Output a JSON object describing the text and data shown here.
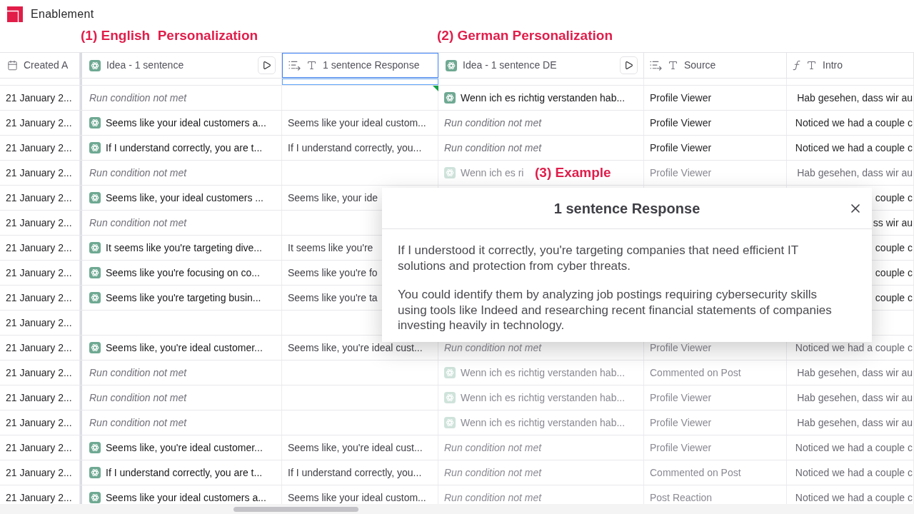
{
  "app": {
    "name": "Enablement"
  },
  "group_labels": [
    "(1) English  Personalization",
    "(2) German Personalization"
  ],
  "table": {
    "columns": [
      {
        "label": "Created A",
        "kind": "date",
        "selected": false
      },
      {
        "label": "Idea - 1 sentence",
        "kind": "ai",
        "selected": false
      },
      {
        "label": "1 sentence Response",
        "kind": "lookup",
        "selected": true
      },
      {
        "label": "Idea - 1 sentence DE",
        "kind": "ai",
        "selected": false
      },
      {
        "label": "Source",
        "kind": "lookup",
        "selected": false
      },
      {
        "label": "Intro",
        "kind": "formula",
        "selected": false
      }
    ],
    "rows": [
      {
        "dimmed": false,
        "cells": [
          {
            "kind": "text",
            "text": "21 January 2..."
          },
          {
            "kind": "skipped",
            "text": "Run condition not met"
          },
          null,
          {
            "kind": "ai",
            "text": "Wenn ich es richtig verstanden hab..."
          },
          {
            "kind": "text",
            "text": "Profile Viewer"
          },
          {
            "kind": "text",
            "text": "Hab gesehen, dass wir au"
          }
        ]
      },
      {
        "dimmed": false,
        "cells": [
          {
            "kind": "text",
            "text": "21 January 2..."
          },
          {
            "kind": "ai",
            "text": "Seems like your ideal customers a..."
          },
          {
            "kind": "text",
            "text": "Seems like your ideal custom..."
          },
          {
            "kind": "skipped",
            "text": "Run condition not met"
          },
          {
            "kind": "text",
            "text": "Profile Viewer"
          },
          {
            "kind": "text",
            "text": "Noticed we had a couple c"
          }
        ]
      },
      {
        "dimmed": false,
        "cells": [
          {
            "kind": "text",
            "text": "21 January 2..."
          },
          {
            "kind": "ai",
            "text": "If I understand correctly, you are t..."
          },
          {
            "kind": "text",
            "text": "If I understand correctly, you..."
          },
          {
            "kind": "skipped",
            "text": "Run condition not met"
          },
          {
            "kind": "text",
            "text": "Profile Viewer"
          },
          {
            "kind": "text",
            "text": "Noticed we had a couple c"
          }
        ]
      },
      {
        "dimmed": true,
        "cells": [
          {
            "kind": "text",
            "text": "21 January 2..."
          },
          {
            "kind": "skipped",
            "text": "Run condition not met"
          },
          null,
          {
            "kind": "ai",
            "text": "Wenn ich es ri"
          },
          {
            "kind": "text",
            "text": "Profile Viewer"
          },
          {
            "kind": "text",
            "text": "Hab gesehen, dass wir au"
          }
        ]
      },
      {
        "dimmed": false,
        "cells": [
          {
            "kind": "text",
            "text": "21 January 2..."
          },
          {
            "kind": "ai",
            "text": "Seems like, your ideal customers ..."
          },
          {
            "kind": "text",
            "text": "Seems like, your ide"
          },
          null,
          null,
          {
            "kind": "text",
            "text": "couple c"
          }
        ]
      },
      {
        "dimmed": false,
        "cells": [
          {
            "kind": "text",
            "text": "21 January 2..."
          },
          {
            "kind": "skipped",
            "text": "Run condition not met"
          },
          null,
          null,
          null,
          {
            "kind": "text",
            "text": "ss wir au"
          }
        ]
      },
      {
        "dimmed": false,
        "cells": [
          {
            "kind": "text",
            "text": "21 January 2..."
          },
          {
            "kind": "ai",
            "text": "It seems like you're targeting dive..."
          },
          {
            "kind": "text",
            "text": "It seems like you're"
          },
          null,
          null,
          {
            "kind": "text",
            "text": "couple c"
          }
        ]
      },
      {
        "dimmed": false,
        "cells": [
          {
            "kind": "text",
            "text": "21 January 2..."
          },
          {
            "kind": "ai",
            "text": "Seems like you're focusing on co..."
          },
          {
            "kind": "text",
            "text": "Seems like you're fo"
          },
          null,
          null,
          {
            "kind": "text",
            "text": "couple c"
          }
        ]
      },
      {
        "dimmed": false,
        "cells": [
          {
            "kind": "text",
            "text": "21 January 2..."
          },
          {
            "kind": "ai",
            "text": "Seems like you're targeting busin..."
          },
          {
            "kind": "text",
            "text": "Seems like you're ta"
          },
          null,
          null,
          {
            "kind": "text",
            "text": "couple c"
          }
        ]
      },
      {
        "cells": [
          {
            "kind": "text",
            "text": "21 January 2..."
          },
          null,
          null,
          null,
          null,
          null
        ]
      },
      {
        "dimmed": true,
        "cells": [
          {
            "kind": "text",
            "text": "21 January 2..."
          },
          {
            "kind": "ai",
            "text": "Seems like, you're ideal customer..."
          },
          {
            "kind": "text",
            "text": "Seems like, you're ideal cust..."
          },
          {
            "kind": "skipped",
            "text": "Run condition not met"
          },
          {
            "kind": "text",
            "text": "Profile Viewer"
          },
          {
            "kind": "text",
            "text": "Noticed we had a couple c"
          }
        ]
      },
      {
        "dimmed": true,
        "cells": [
          {
            "kind": "text",
            "text": "21 January 2..."
          },
          {
            "kind": "skipped",
            "text": "Run condition not met"
          },
          null,
          {
            "kind": "ai",
            "text": "Wenn ich es richtig verstanden hab..."
          },
          {
            "kind": "text",
            "text": "Commented on Post"
          },
          {
            "kind": "text",
            "text": "Hab gesehen, dass wir au"
          }
        ]
      },
      {
        "dimmed": true,
        "cells": [
          {
            "kind": "text",
            "text": "21 January 2..."
          },
          {
            "kind": "skipped",
            "text": "Run condition not met"
          },
          null,
          {
            "kind": "ai",
            "text": "Wenn ich es richtig verstanden hab..."
          },
          {
            "kind": "text",
            "text": "Profile Viewer"
          },
          {
            "kind": "text",
            "text": "Hab gesehen, dass wir au"
          }
        ]
      },
      {
        "dimmed": true,
        "cells": [
          {
            "kind": "text",
            "text": "21 January 2..."
          },
          {
            "kind": "skipped",
            "text": "Run condition not met"
          },
          null,
          {
            "kind": "ai",
            "text": "Wenn ich es richtig verstanden hab..."
          },
          {
            "kind": "text",
            "text": "Profile Viewer"
          },
          {
            "kind": "text",
            "text": "Hab gesehen, dass wir au"
          }
        ]
      },
      {
        "dimmed": true,
        "cells": [
          {
            "kind": "text",
            "text": "21 January 2..."
          },
          {
            "kind": "ai",
            "text": "Seems like, you're ideal customer..."
          },
          {
            "kind": "text",
            "text": "Seems like, you're ideal cust..."
          },
          {
            "kind": "skipped",
            "text": "Run condition not met"
          },
          {
            "kind": "text",
            "text": "Profile Viewer"
          },
          {
            "kind": "text",
            "text": "Noticed we had a couple c"
          }
        ]
      },
      {
        "dimmed": true,
        "cells": [
          {
            "kind": "text",
            "text": "21 January 2..."
          },
          {
            "kind": "ai",
            "text": "If I understand correctly, you are t..."
          },
          {
            "kind": "text",
            "text": "If I understand correctly, you..."
          },
          {
            "kind": "skipped",
            "text": "Run condition not met"
          },
          {
            "kind": "text",
            "text": "Commented on Post"
          },
          {
            "kind": "text",
            "text": "Noticed we had a couple c"
          }
        ]
      },
      {
        "dimmed": true,
        "cells": [
          {
            "kind": "text",
            "text": "21 January 2..."
          },
          {
            "kind": "ai",
            "text": "Seems like your ideal customers a..."
          },
          {
            "kind": "text",
            "text": "Seems like your ideal custom..."
          },
          {
            "kind": "skipped",
            "text": "Run condition not met"
          },
          {
            "kind": "text",
            "text": "Post Reaction"
          },
          {
            "kind": "text",
            "text": "Noticed we had a couple c"
          }
        ]
      }
    ]
  },
  "popup": {
    "callout": "(3) Example",
    "title": "1 sentence Response",
    "paragraphs": [
      "If I understood it correctly, you're targeting companies that need efficient IT solutions and protection from cyber threats.",
      "You could identify them by analyzing job postings requiring cybersecurity skills using tools like Indeed and researching recent financial statements of companies investing heavily in technology."
    ]
  }
}
